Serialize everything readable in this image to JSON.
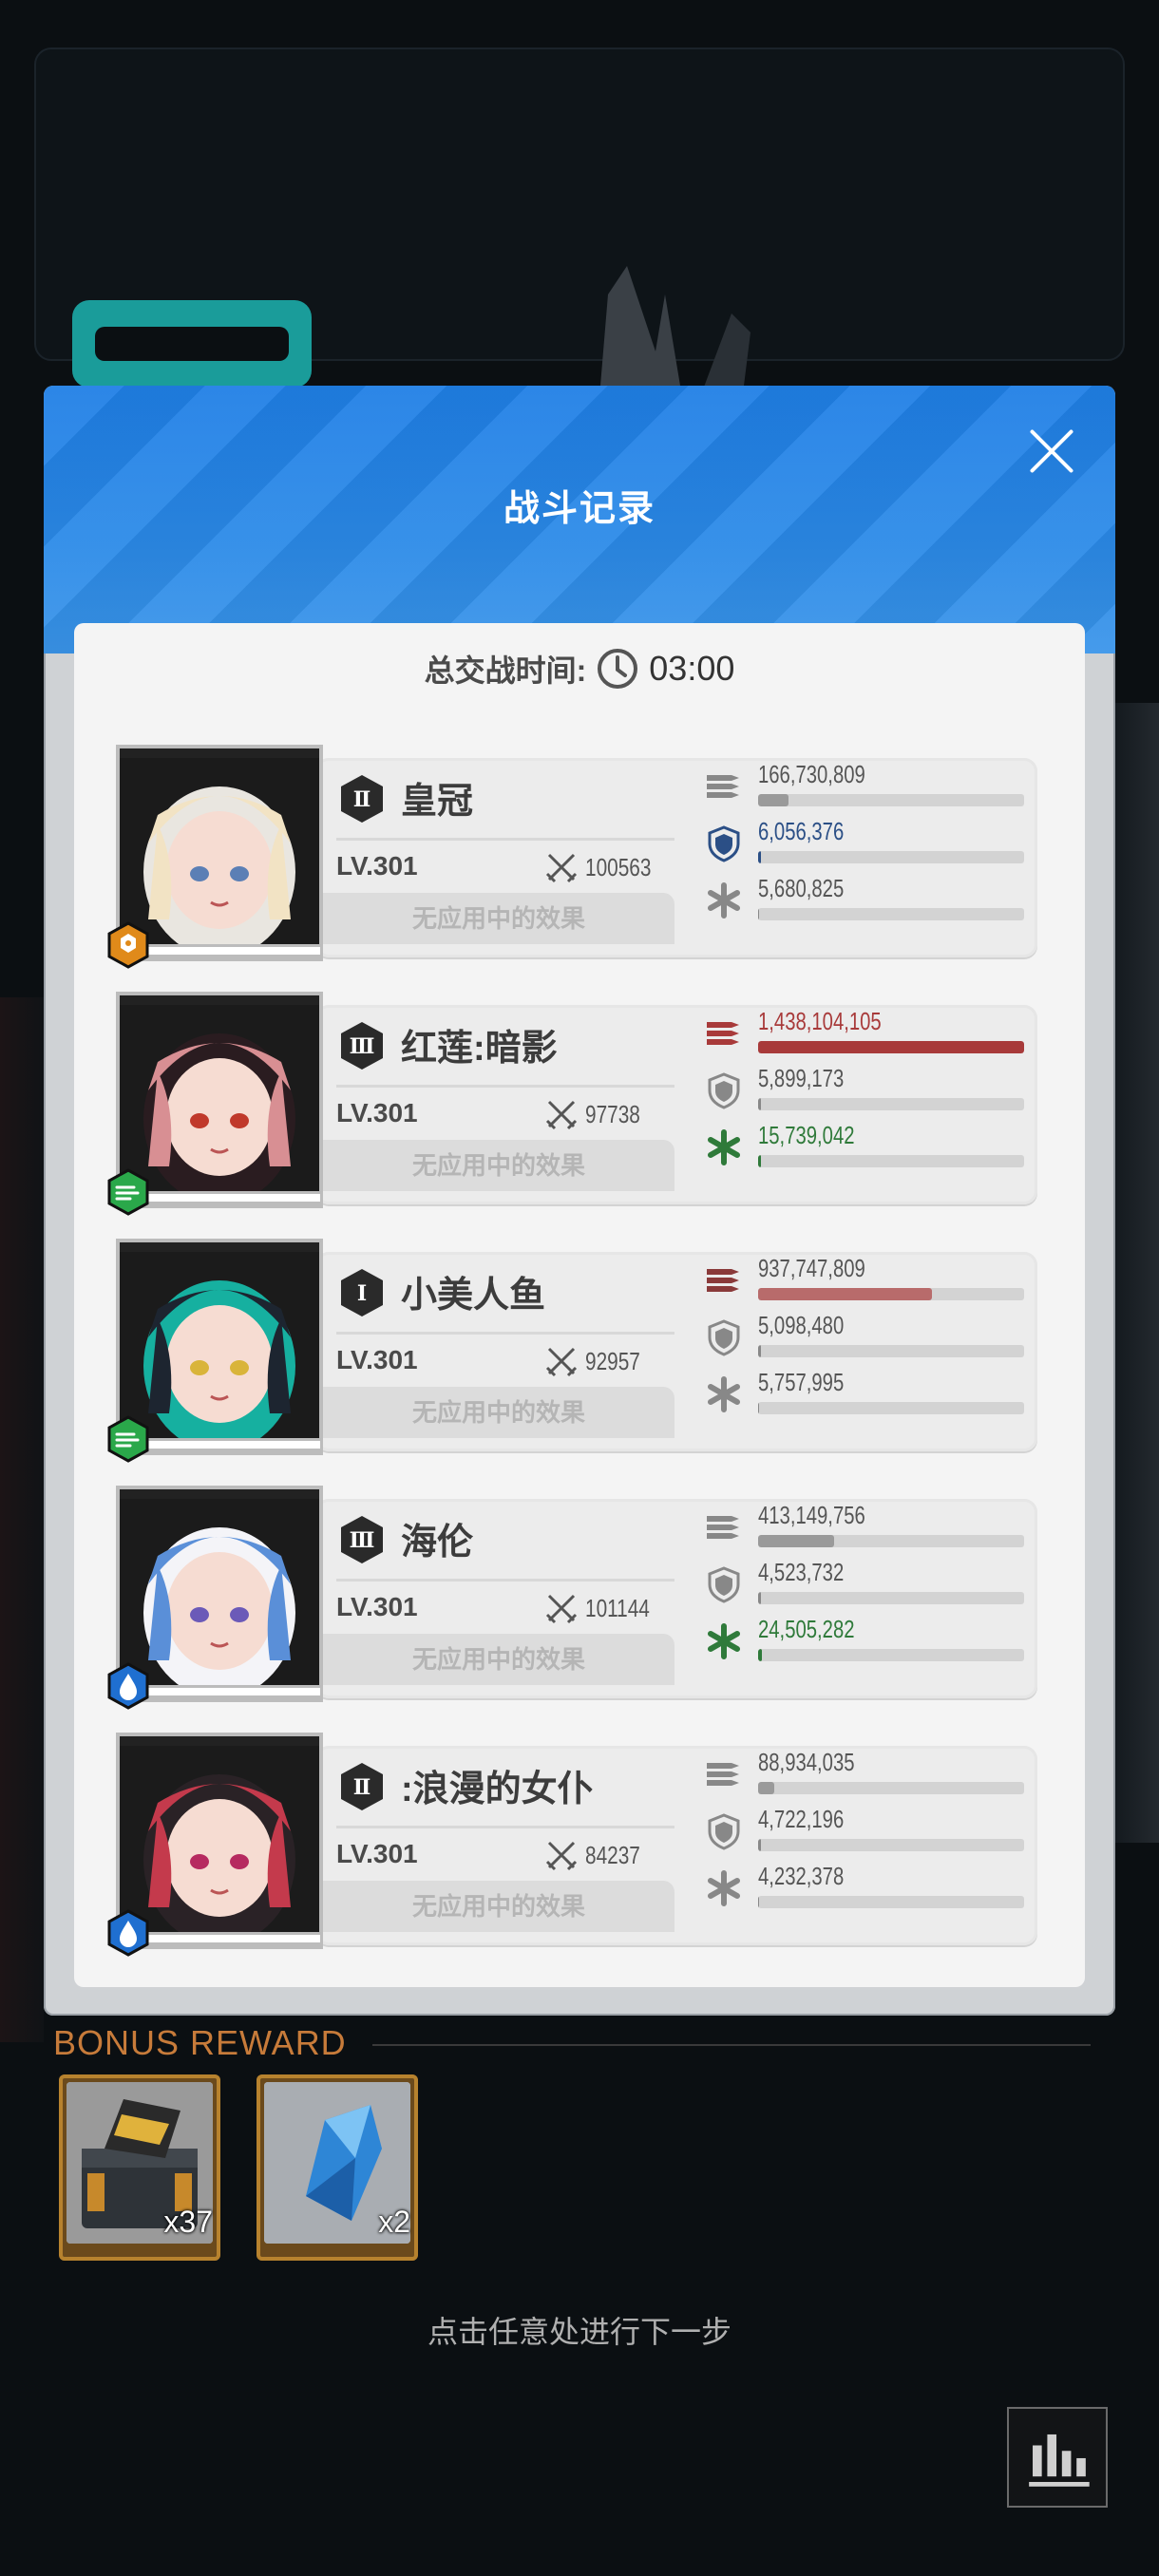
{
  "dialog": {
    "title": "战斗记录",
    "duration_label": "总交战时间:",
    "duration_value": "03:00"
  },
  "effect_text": "无应用中的效果",
  "characters": [
    {
      "rank": "Ⅱ",
      "name": "皇冠",
      "level": "LV.301",
      "power": "100563",
      "element": "iron",
      "damage": "166,730,809",
      "damage_ratio": 0.116,
      "shield": "6,056,376",
      "shield_ratio": 0.01,
      "heal": "5,680,825",
      "heal_ratio": 0.005,
      "highlight": "shield"
    },
    {
      "rank": "Ⅲ",
      "name": "红莲:暗影",
      "level": "LV.301",
      "power": "97738",
      "element": "wind",
      "damage": "1,438,104,105",
      "damage_ratio": 1.0,
      "shield": "5,899,173",
      "shield_ratio": 0.01,
      "heal": "15,739,042",
      "heal_ratio": 0.01,
      "highlight": "damage"
    },
    {
      "rank": "Ⅰ",
      "name": "小美人鱼",
      "level": "LV.301",
      "power": "92957",
      "element": "wind",
      "damage": "937,747,809",
      "damage_ratio": 0.652,
      "shield": "5,098,480",
      "shield_ratio": 0.01,
      "heal": "5,757,995",
      "heal_ratio": 0.005,
      "highlight": "none"
    },
    {
      "rank": "Ⅲ",
      "name": "海伦",
      "level": "LV.301",
      "power": "101144",
      "element": "water",
      "damage": "413,149,756",
      "damage_ratio": 0.287,
      "shield": "4,523,732",
      "shield_ratio": 0.01,
      "heal": "24,505,282",
      "heal_ratio": 0.015,
      "highlight": "heal"
    },
    {
      "rank": "Ⅱ",
      "name": ":浪漫的女仆",
      "level": "LV.301",
      "power": "84237",
      "element": "water",
      "damage": "88,934,035",
      "damage_ratio": 0.062,
      "shield": "4,722,196",
      "shield_ratio": 0.01,
      "heal": "4,232,378",
      "heal_ratio": 0.005,
      "highlight": "none"
    }
  ],
  "bonus": {
    "title": "BONUS REWARD",
    "items": [
      {
        "name": "supply-crate",
        "count": "x37"
      },
      {
        "name": "blue-crystal",
        "count": "x2"
      }
    ]
  },
  "hint": "点击任意处进行下一步",
  "colors": {
    "header_blue": "#1f7fe6",
    "damage_red": "#a83a3a",
    "shield_blue": "#2b4f86",
    "heal_green": "#2f7a3a",
    "bonus_orange": "#c77b3a"
  }
}
